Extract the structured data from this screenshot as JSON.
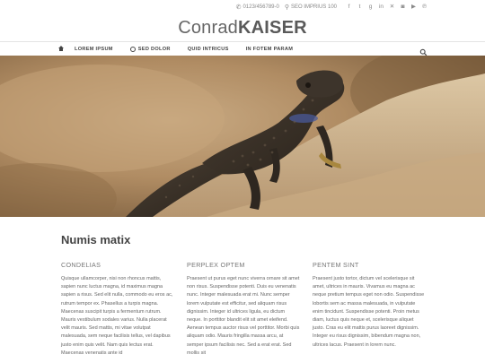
{
  "topbar": {
    "phone": "0123/456789-0",
    "address": "SEO IMPRIUS 100",
    "social_icons": [
      "facebook-icon",
      "twitter-icon",
      "google-plus-icon",
      "linkedin-icon",
      "xing-icon",
      "instagram-icon",
      "youtube-icon",
      "pinterest-icon"
    ]
  },
  "logo": {
    "light": "Conrad",
    "bold": "KAISER"
  },
  "nav": {
    "items": [
      "LOREM IPSUM",
      "SED DOLOR",
      "QUID INTRICUS",
      "IN FOTEM PARAM"
    ]
  },
  "hero": {
    "icon": "lizard-photo"
  },
  "content": {
    "heading": "Numis matix",
    "columns": [
      {
        "title": "CONDELIAS",
        "text": "Quisque ullamcorper, nisi non rhoncus mattis, sapien nunc luctus magna, id maximus magna sapien a risus. Sed elit nulla, commodo eu eros ac, rutrum tempor ex. Phasellus a turpis magna. Maecenas suscipit turpis a fermentum rutrum. Mauris vestibulum sodales varius. Nulla placerat velit mauris. Sed mattis, mi vitae volutpat malesuada, sem neque facilisis tellus, vel dapibus justo enim quis velit. Nam quis lectus erat. Maecenas venenatis ante id"
      },
      {
        "title": "PERPLEX OPTEM",
        "text": "Praesent ut purus eget nunc viverra ornare sit amet non risus. Suspendisse potenti. Duis eu venenatis nunc. Integer malesuada erat mi. Nunc semper lorem vulputate est efficitur, sed aliquam risus dignissim. Integer id ultrices ligula, eu dictum neque. In porttitor blandit elit sit amet eleifend. Aenean tempus auctor risus vel porttitor. Morbi quis aliquam odio. Mauris fringilla massa arcu, at semper ipsum facilisis nec. Sed a erat erat. Sed mollis sit"
      },
      {
        "title": "PENTEM SINT",
        "text": "Praesent justo tortor, dictum vel scelerisque sit amet, ultrices in mauris. Vivamus eu magna ac neque pretium tempus eget non odio. Suspendisse lobortis sem ac massa malesuada, in vulputate enim tincidunt. Suspendisse potenti. Proin metus diam, luctus quis neque et, scelerisque aliquet justo. Cras eu elit mattis purus laoreet dignissim. Integer eu risus dignissim, bibendum magna non, ultrices lacus. Praesent in lorem nunc."
      }
    ]
  }
}
